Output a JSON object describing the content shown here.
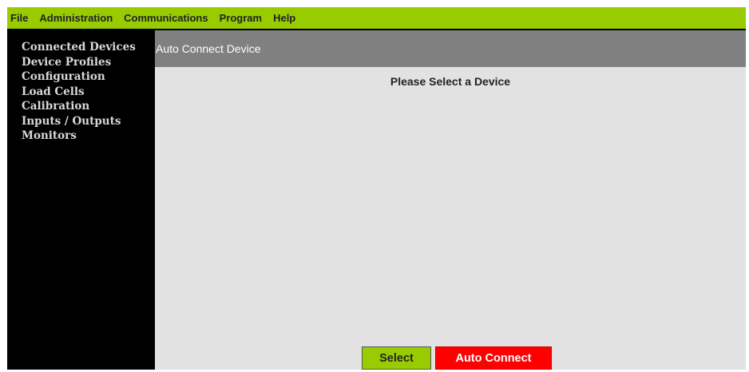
{
  "menu": {
    "items": [
      {
        "label": "File"
      },
      {
        "label": "Administration"
      },
      {
        "label": "Communications"
      },
      {
        "label": "Program"
      },
      {
        "label": "Help"
      }
    ]
  },
  "sidebar": {
    "items": [
      {
        "label": "Connected Devices"
      },
      {
        "label": "Device Profiles"
      },
      {
        "label": "Configuration"
      },
      {
        "label": "Load Cells"
      },
      {
        "label": "Calibration"
      },
      {
        "label": "Inputs / Outputs"
      },
      {
        "label": "Monitors"
      }
    ]
  },
  "panel": {
    "title": "Auto Connect Device",
    "prompt": "Please Select a Device"
  },
  "buttons": {
    "select_label": "Select",
    "auto_connect_label": "Auto Connect"
  },
  "colors": {
    "menubar": "#99cc00",
    "sidebar": "#000000",
    "panel_header": "#808080",
    "panel_body": "#e2e2e2",
    "select_button": "#99cc00",
    "auto_connect_button": "#ff0000"
  }
}
